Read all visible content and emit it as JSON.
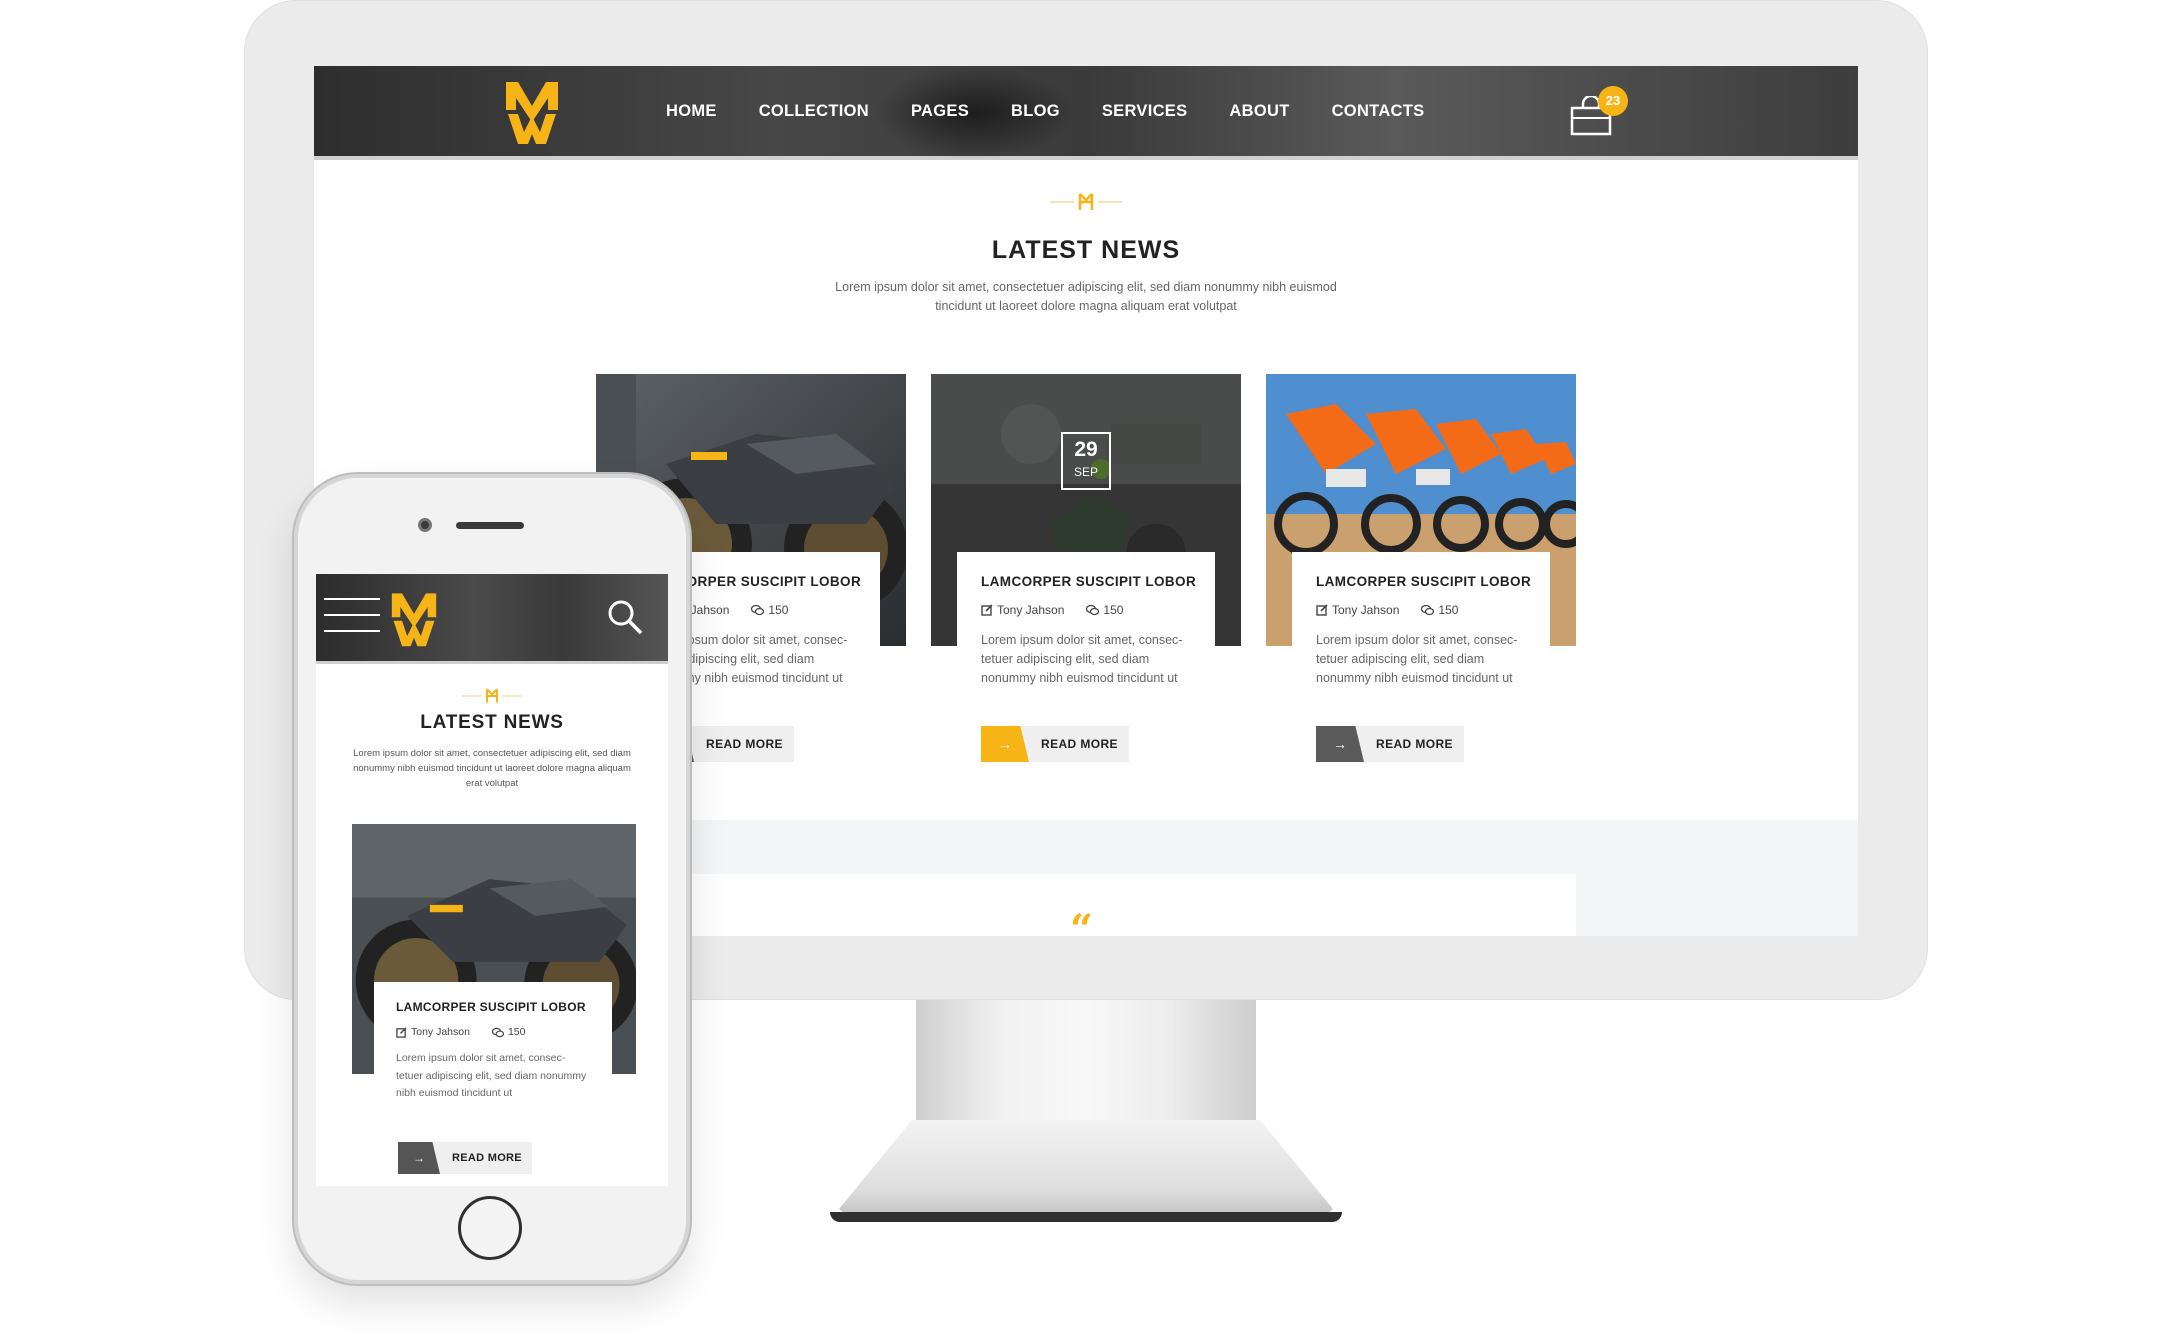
{
  "brand": {
    "accent": "#f7b417",
    "dark": "#3a3a3a"
  },
  "desktop": {
    "nav": [
      "HOME",
      "COLLECTION",
      "PAGES",
      "BLOG",
      "SERVICES",
      "ABOUT",
      "CONTACTS"
    ],
    "cart_count": "23",
    "section": {
      "title": "LATEST NEWS",
      "subtitle_line1": "Lorem ipsum dolor sit amet, consectetuer adipiscing elit, sed diam nonummy nibh euismod",
      "subtitle_line2": "tincidunt ut laoreet dolore magna aliquam erat volutpat"
    },
    "cards": [
      {
        "title": "LAMCORPER SUSCIPIT LOBOR",
        "author": "Tony Jahson",
        "comments": "150",
        "text": "Lorem ipsum dolor sit amet, consec-tetuer adipiscing elit, sed diam nonummy nibh euismod tincidunt ut",
        "read_more": "READ MORE",
        "image": "futuristic-motorcycle"
      },
      {
        "title": "LAMCORPER SUSCIPIT LOBOR",
        "author": "Tony Jahson",
        "comments": "150",
        "text": "Lorem ipsum dolor sit amet, consec-tetuer adipiscing elit, sed diam nonummy nibh euismod tincidunt ut",
        "read_more": "READ MORE",
        "date_day": "29",
        "date_month": "SEP",
        "image": "motocross-rider"
      },
      {
        "title": "LAMCORPER SUSCIPIT LOBOR",
        "author": "Tony Jahson",
        "comments": "150",
        "text": "Lorem ipsum dolor sit amet, consec-tetuer adipiscing elit, sed diam nonummy nibh euismod tincidunt ut",
        "read_more": "READ MORE",
        "image": "orange-dirt-bikes"
      }
    ],
    "quote_mark": "“"
  },
  "mobile": {
    "section": {
      "title": "LATEST NEWS",
      "subtitle": "Lorem ipsum dolor sit amet, consectetuer adipiscing elit, sed diam nonummy nibh euismod tincidunt ut laoreet dolore magna aliquam erat volutpat"
    },
    "card": {
      "title": "LAMCORPER SUSCIPIT LOBOR",
      "author": "Tony Jahson",
      "comments": "150",
      "text": "Lorem ipsum dolor sit amet, consec-tetuer adipiscing elit, sed diam nonummy nibh euismod tincidunt ut",
      "read_more": "READ MORE"
    }
  },
  "icons": {
    "logo": "mw-logo-icon",
    "cart": "shopping-bag-icon",
    "author": "edit-icon",
    "comments": "comments-icon",
    "arrow": "arrow-right-icon",
    "menu": "hamburger-icon",
    "search": "search-icon"
  },
  "glyphs": {
    "arrow": "→"
  }
}
